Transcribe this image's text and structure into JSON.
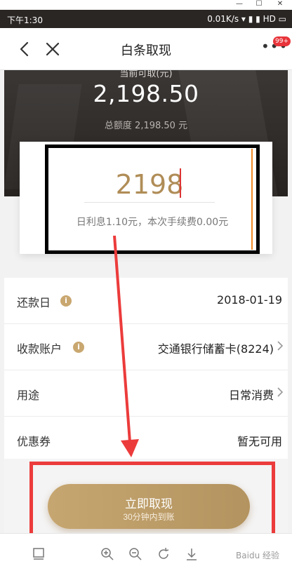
{
  "window": {
    "minimize": "—",
    "maximize": "☐",
    "close": "✕"
  },
  "status_bar": {
    "time": "下午1:30",
    "indicators": "0.01K/s  ▾ ▮ ▮ HD ▭"
  },
  "nav": {
    "title": "白条取现",
    "badge": "99+",
    "more": "•••"
  },
  "hero": {
    "label": "当前可取(元)",
    "amount": "2,198.50",
    "total_line": "总额度 2,198.50 元"
  },
  "input": {
    "value": "2198",
    "interest_note": "日利息1.10元，本次手续费0.00元"
  },
  "rows": [
    {
      "label": "还款日",
      "value": "2018-01-19",
      "has_info": true,
      "has_chevron": false
    },
    {
      "label": "收款账户",
      "value": "交通银行储蓄卡(8224)",
      "has_info": true,
      "has_chevron": true
    },
    {
      "label": "用途",
      "value": "日常消费",
      "has_info": false,
      "has_chevron": true
    },
    {
      "label": "优惠券",
      "value": "暂无可用",
      "has_info": false,
      "has_chevron": false
    }
  ],
  "button": {
    "label": "立即取现",
    "sub_label": "30分钟内到账"
  },
  "toolbar": {
    "watermark": "Baidu 经验"
  },
  "colors": {
    "gold": "#b08d57",
    "annotation_red": "#ec3b3b",
    "hero_dark": "#2f2b29"
  }
}
